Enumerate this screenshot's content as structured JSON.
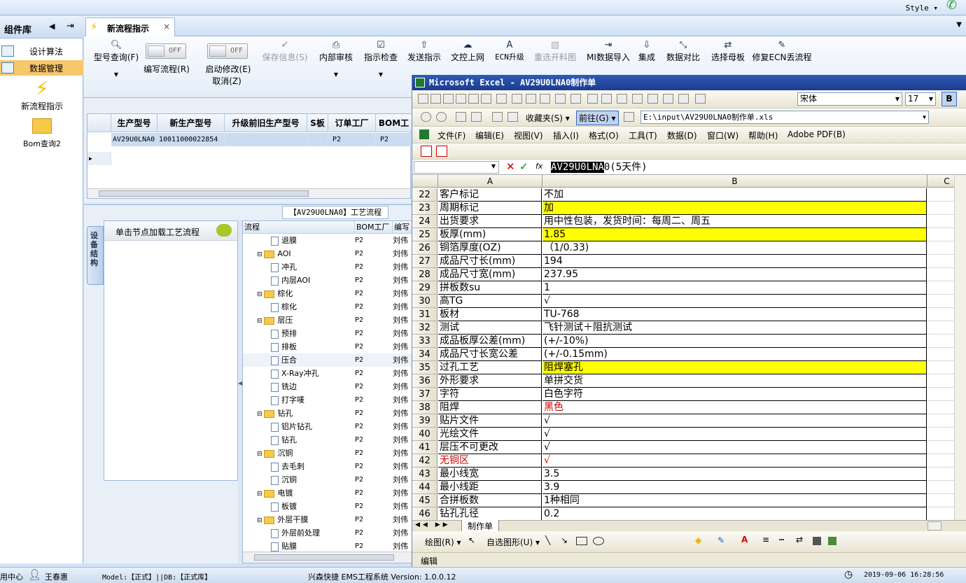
{
  "topbar": {
    "style_label": "Style ▾"
  },
  "left_panel": {
    "title": "组件库",
    "items": [
      {
        "label": "设计算法"
      },
      {
        "label": "数据管理"
      }
    ],
    "icons": [
      {
        "label": "新流程指示"
      },
      {
        "label": "Bom查询2"
      }
    ]
  },
  "tab": {
    "label": "新流程指示",
    "close": "×"
  },
  "toolbar": {
    "model_query": "型号查询(F)",
    "write_flow_toggle": "OFF",
    "write_flow": "编写流程(R)",
    "start_modify_toggle": "OFF",
    "start_modify": "启动修改(E)",
    "cancel": "取消(Z)",
    "save_info": "保存信息(S)",
    "internal_review": "内部审核",
    "check": "指示检查",
    "send": "发送指示",
    "upload": "文控上网",
    "ecn_upgrade": "ECN升级",
    "reselect_chart": "重选开料图",
    "mi_import": "MI数据导入",
    "integrate": "集成",
    "compare": "数据对比",
    "select_master": "选择母板",
    "repair_ecn": "修复ECN丢流程"
  },
  "grid": {
    "headers": [
      "生产型号",
      "新生产型号",
      "升级前旧生产型号",
      "S板",
      "订单工厂",
      "BOM工厂"
    ],
    "row": [
      "AV29U0LNA0",
      "10011000022854",
      "",
      "",
      "P2",
      "P2"
    ]
  },
  "process": {
    "title": "【AV29U0LNA0】工艺流程",
    "side_tab": "设备结构",
    "node_hint": "单击节点加载工艺流程",
    "tree_headers": [
      "流程",
      "BOM工厂",
      "编写"
    ],
    "tree": [
      {
        "label": "退膜",
        "type": "doc",
        "level": 2,
        "factory": "P2",
        "user": "刘伟"
      },
      {
        "label": "AOI",
        "type": "folder",
        "level": 1,
        "factory": "P2",
        "user": "刘伟"
      },
      {
        "label": "冲孔",
        "type": "doc",
        "level": 2,
        "factory": "P2",
        "user": "刘伟"
      },
      {
        "label": "内层AOI",
        "type": "doc",
        "level": 2,
        "factory": "P2",
        "user": "刘伟"
      },
      {
        "label": "棕化",
        "type": "folder",
        "level": 1,
        "factory": "P2",
        "user": "刘伟"
      },
      {
        "label": "棕化",
        "type": "doc",
        "level": 2,
        "factory": "P2",
        "user": "刘伟"
      },
      {
        "label": "层压",
        "type": "folder",
        "level": 1,
        "factory": "P2",
        "user": "刘伟"
      },
      {
        "label": "预排",
        "type": "doc",
        "level": 2,
        "factory": "P2",
        "user": "刘伟"
      },
      {
        "label": "排板",
        "type": "doc",
        "level": 2,
        "factory": "P2",
        "user": "刘伟"
      },
      {
        "label": "压合",
        "type": "doc",
        "level": 2,
        "factory": "P2",
        "user": "刘伟"
      },
      {
        "label": "X-Ray冲孔",
        "type": "doc",
        "level": 2,
        "factory": "P2",
        "user": "刘伟"
      },
      {
        "label": "铣边",
        "type": "doc",
        "level": 2,
        "factory": "P2",
        "user": "刘伟"
      },
      {
        "label": "打字唛",
        "type": "doc",
        "level": 2,
        "factory": "P2",
        "user": "刘伟"
      },
      {
        "label": "钻孔",
        "type": "folder",
        "level": 1,
        "factory": "P2",
        "user": "刘伟"
      },
      {
        "label": "铝片钻孔",
        "type": "doc",
        "level": 2,
        "factory": "P2",
        "user": "刘伟"
      },
      {
        "label": "钻孔",
        "type": "doc",
        "level": 2,
        "factory": "P2",
        "user": "刘伟"
      },
      {
        "label": "沉铜",
        "type": "folder",
        "level": 1,
        "factory": "P2",
        "user": "刘伟"
      },
      {
        "label": "去毛刺",
        "type": "doc",
        "level": 2,
        "factory": "P2",
        "user": "刘伟"
      },
      {
        "label": "沉铜",
        "type": "doc",
        "level": 2,
        "factory": "P2",
        "user": "刘伟"
      },
      {
        "label": "电镀",
        "type": "folder",
        "level": 1,
        "factory": "P2",
        "user": "刘伟"
      },
      {
        "label": "板镀",
        "type": "doc",
        "level": 2,
        "factory": "P2",
        "user": "刘伟"
      },
      {
        "label": "外层干膜",
        "type": "folder",
        "level": 1,
        "factory": "P2",
        "user": "刘伟"
      },
      {
        "label": "外层前处理",
        "type": "doc",
        "level": 2,
        "factory": "P2",
        "user": "刘伟"
      },
      {
        "label": "贴膜",
        "type": "doc",
        "level": 2,
        "factory": "P2",
        "user": "刘伟"
      }
    ]
  },
  "excel": {
    "title": "Microsoft Excel - AV29U0LNA0制作单",
    "font": "宋体",
    "font_size": "17",
    "bold": "B",
    "favorites": "收藏夹(S) ▾",
    "goto": "前往(G) ▾",
    "path": "E:\\input\\AV29U0LNA0制作单.xls",
    "menu": [
      "文件(F)",
      "编辑(E)",
      "视图(V)",
      "插入(I)",
      "格式(O)",
      "工具(T)",
      "数据(D)",
      "窗口(W)",
      "帮助(H)",
      "Adobe PDF(B)"
    ],
    "formula_sel": "AV29U0LNA",
    "formula_rest": "0(5天件)",
    "cols": [
      "A",
      "B",
      "C"
    ],
    "rows": [
      {
        "n": "22",
        "a": "客户标记",
        "b": "不加"
      },
      {
        "n": "23",
        "a": "周期标记",
        "b": "加",
        "yel": true
      },
      {
        "n": "24",
        "a": "出货要求",
        "b": "用中性包装，发货时间：每周二、周五"
      },
      {
        "n": "25",
        "a": "板厚(mm)",
        "b": "1.85",
        "yel": true
      },
      {
        "n": "26",
        "a": "铜箔厚度(OZ)",
        "b": "（1/0.33)"
      },
      {
        "n": "27",
        "a": "成品尺寸长(mm)",
        "b": "194"
      },
      {
        "n": "28",
        "a": "成品尺寸宽(mm)",
        "b": "237.95"
      },
      {
        "n": "29",
        "a": "拼板数su",
        "b": "1"
      },
      {
        "n": "30",
        "a": "高TG",
        "b": "√"
      },
      {
        "n": "31",
        "a": "板材",
        "b": "TU-768"
      },
      {
        "n": "32",
        "a": "测试",
        "b": "飞针测试＋阻抗测试"
      },
      {
        "n": "33",
        "a": "成品板厚公差(mm)",
        "b": "(+/-10%)"
      },
      {
        "n": "34",
        "a": "成品尺寸长宽公差",
        "b": "(+/-0.15mm)"
      },
      {
        "n": "35",
        "a": "过孔工艺",
        "b": "阻焊塞孔",
        "yel": true
      },
      {
        "n": "36",
        "a": "外形要求",
        "b": "单拼交货"
      },
      {
        "n": "37",
        "a": "字符",
        "b": "白色字符"
      },
      {
        "n": "38",
        "a": "阻焊",
        "b": "黑色",
        "bred": true
      },
      {
        "n": "39",
        "a": "贴片文件",
        "b": "√"
      },
      {
        "n": "40",
        "a": "光绘文件",
        "b": "√"
      },
      {
        "n": "41",
        "a": "层压不可更改",
        "b": "√"
      },
      {
        "n": "42",
        "a": "无铜区",
        "b": "√",
        "ared": true,
        "bred": true
      },
      {
        "n": "43",
        "a": "最小线宽",
        "b": "3.5"
      },
      {
        "n": "44",
        "a": "最小线距",
        "b": "3.9"
      },
      {
        "n": "45",
        "a": "合拼板数",
        "b": "1种相同"
      },
      {
        "n": "46",
        "a": "钻孔孔径",
        "b": "0.2"
      }
    ],
    "sheet_tab": "制作单",
    "draw_label": "绘图(R) ▾",
    "autoshape": "自选图形(U) ▾",
    "status": "编辑"
  },
  "status": {
    "center": "用中心",
    "user": "王春惠",
    "model": "Model:【正式】||DB:【正式库】",
    "system": "兴森快捷 EMS工程系统 Version: 1.0.0.12",
    "datetime": "2019-09-06 16:28:56"
  }
}
